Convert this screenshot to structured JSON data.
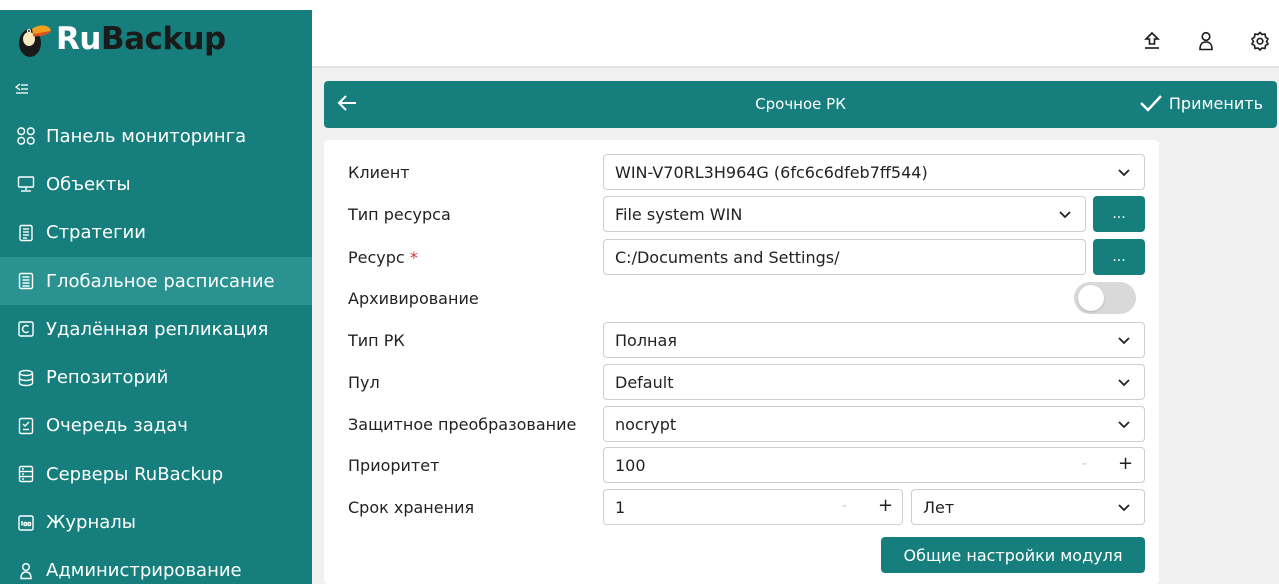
{
  "app": {
    "logo_ru": "Ru",
    "logo_backup": "Backup",
    "collapse_symbol": "<="
  },
  "sidebar": {
    "items": [
      {
        "label": "Панель мониторинга",
        "icon": "dashboard-icon"
      },
      {
        "label": "Объекты",
        "icon": "monitor-icon"
      },
      {
        "label": "Стратегии",
        "icon": "document-icon"
      },
      {
        "label": "Глобальное расписание",
        "icon": "schedule-icon",
        "active": true
      },
      {
        "label": "Удалённая репликация",
        "icon": "replication-icon"
      },
      {
        "label": "Репозиторий",
        "icon": "database-icon"
      },
      {
        "label": "Очередь задач",
        "icon": "task-queue-icon"
      },
      {
        "label": "Серверы RuBackup",
        "icon": "server-icon"
      },
      {
        "label": "Журналы",
        "icon": "log-icon"
      },
      {
        "label": "Администрирование",
        "icon": "admin-user-icon"
      }
    ]
  },
  "header": {
    "icons": [
      "upload-icon",
      "user-icon",
      "settings-icon"
    ]
  },
  "panel": {
    "title": "Срочное РК",
    "apply_label": "Применить"
  },
  "form": {
    "client_label": "Клиент",
    "client_value": "WIN-V70RL3H964G (6fc6c6dfeb7ff544)",
    "resource_type_label": "Тип ресурса",
    "resource_type_value": "File system WIN",
    "resource_label": "Ресурс",
    "resource_required": "*",
    "resource_value": "C:/Documents and Settings/",
    "dots_label": "...",
    "archive_label": "Архивирование",
    "archive_enabled": false,
    "backup_type_label": "Тип РК",
    "backup_type_value": "Полная",
    "pool_label": "Пул",
    "pool_value": "Default",
    "protection_label": "Защитное преобразование",
    "protection_value": "nocrypt",
    "priority_label": "Приоритет",
    "priority_value": "100",
    "retention_label": "Срок хранения",
    "retention_value": "1",
    "retention_unit": "Лет",
    "minus": "-",
    "plus": "+",
    "general_settings_label": "Общие настройки модуля"
  },
  "colors": {
    "primary": "#167f7d",
    "active_item": "#2a9391",
    "required": "#d0342c"
  }
}
